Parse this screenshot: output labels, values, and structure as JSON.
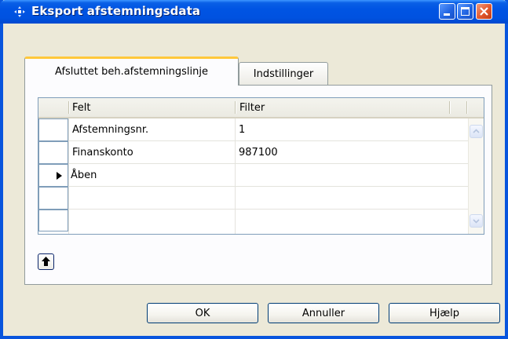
{
  "window": {
    "title": "Eksport afstemningsdata",
    "icon": "move-arrows-icon"
  },
  "tabs": [
    {
      "label": "Afsluttet beh.afstemningslinje",
      "active": true
    },
    {
      "label": "Indstillinger",
      "active": false
    }
  ],
  "grid": {
    "columns": [
      "Felt",
      "Filter"
    ],
    "rows": [
      {
        "field": "Afstemningsnr.",
        "filter": "1",
        "current": false
      },
      {
        "field": "Finanskonto",
        "filter": "987100",
        "current": false
      },
      {
        "field": "Åben",
        "filter": "",
        "current": true
      },
      {
        "field": "",
        "filter": "",
        "current": false
      },
      {
        "field": "",
        "filter": "",
        "current": false
      }
    ]
  },
  "buttons": {
    "ok": "OK",
    "cancel": "Annuller",
    "help": "Hjælp"
  },
  "colors": {
    "titlebar": "#0054e3",
    "close_button": "#e2572c",
    "active_tab_highlight": "#ffc83c",
    "face": "#ece9d8"
  }
}
